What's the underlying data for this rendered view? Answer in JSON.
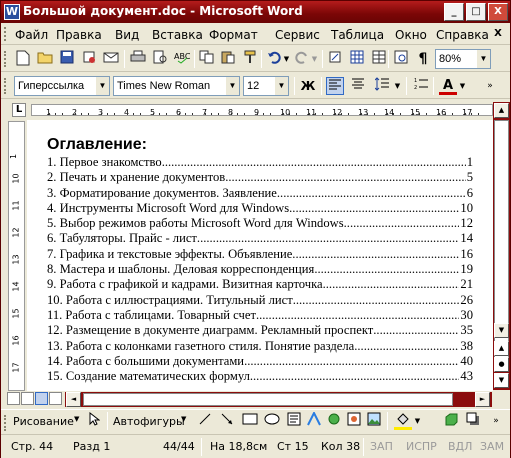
{
  "window": {
    "title": "Большой документ.doc - Microsoft Word",
    "app_icon": "W"
  },
  "title_buttons": {
    "minimize": "_",
    "maximize": "□",
    "close": "X"
  },
  "menu": {
    "items": [
      "Файл",
      "Правка",
      "Вид",
      "Вставка",
      "Формат",
      "Сервис",
      "Таблица",
      "Окно",
      "Справка"
    ],
    "doc_close": "X"
  },
  "standard_toolbar": {
    "zoom": "80%",
    "icons": [
      "new-document-icon",
      "open-folder-icon",
      "save-icon",
      "permission-icon",
      "email-icon",
      "print-icon",
      "print-preview-icon",
      "spelling-icon",
      "copy-icon",
      "paste-icon",
      "format-painter-icon",
      "undo-icon",
      "redo-icon",
      "insert-hyperlink-icon",
      "tables-borders-icon",
      "insert-table-icon",
      "columns-icon",
      "document-map-icon",
      "show-formatting-icon"
    ]
  },
  "formatting_toolbar": {
    "style": "Гиперссылка",
    "font": "Times New Roman",
    "size": "12",
    "bold_label": "Ж",
    "font_color_label": "A",
    "icons": [
      "align-left-icon",
      "align-center-icon",
      "line-spacing-icon",
      "numbering-icon",
      "font-color-icon"
    ]
  },
  "document": {
    "heading": "Оглавление:",
    "toc": [
      {
        "title": "1. Первое знакомство",
        "page": "1"
      },
      {
        "title": "2. Печать и хранение документов",
        "page": "5"
      },
      {
        "title": "3. Форматирование документов. Заявление",
        "page": "6"
      },
      {
        "title": "4. Инструменты Microsoft Word для Windows",
        "page": "10"
      },
      {
        "title": "5. Выбор режимов работы Microsoft Word для Windows",
        "page": "12"
      },
      {
        "title": "6. Табуляторы. Прайс - лист",
        "page": "14"
      },
      {
        "title": "7. Графика и текстовые эффекты. Объявление",
        "page": "16"
      },
      {
        "title": "8. Мастера и шаблоны. Деловая корреспонденция",
        "page": "19"
      },
      {
        "title": "9. Работа с графикой и кадрами. Визитная карточка",
        "page": "21"
      },
      {
        "title": "10. Работа с иллюстрациями. Титульный лист",
        "page": "26"
      },
      {
        "title": "11. Работа с таблицами. Товарный счет",
        "page": "30"
      },
      {
        "title": "12. Размещение в документе диаграмм. Рекламный проспект",
        "page": "35"
      },
      {
        "title": "13. Работа с колонками газетного стиля. Понятие раздела",
        "page": "38"
      },
      {
        "title": "14. Работа с большими документами",
        "page": "40"
      },
      {
        "title": "15. Создание математических формул",
        "page": "43"
      }
    ]
  },
  "ruler": {
    "h_numbers": [
      "1",
      "2",
      "3",
      "4",
      "5",
      "6",
      "7",
      "8",
      "9",
      "10",
      "11",
      "12",
      "13",
      "14",
      "15",
      "16",
      "17"
    ],
    "v_numbers": [
      "1",
      "10",
      "11",
      "12",
      "13",
      "14",
      "15",
      "16",
      "17"
    ]
  },
  "drawing_toolbar": {
    "draw_label": "Рисование",
    "autoshapes_label": "Автофигуры"
  },
  "status_bar": {
    "page": "Стр. 44",
    "section": "Разд 1",
    "page_of": "44/44",
    "at": "На 18,8см",
    "line": "Ст 15",
    "col": "Кол 38",
    "rec": "ЗАП",
    "trk": "ИСПР",
    "ext": "ВДЛ",
    "ovr": "ЗАМ"
  },
  "colors": {
    "title_bar": "#8b0a0a",
    "accent_dark_red": "#7a0c0c",
    "chrome": "#ece9d8"
  }
}
